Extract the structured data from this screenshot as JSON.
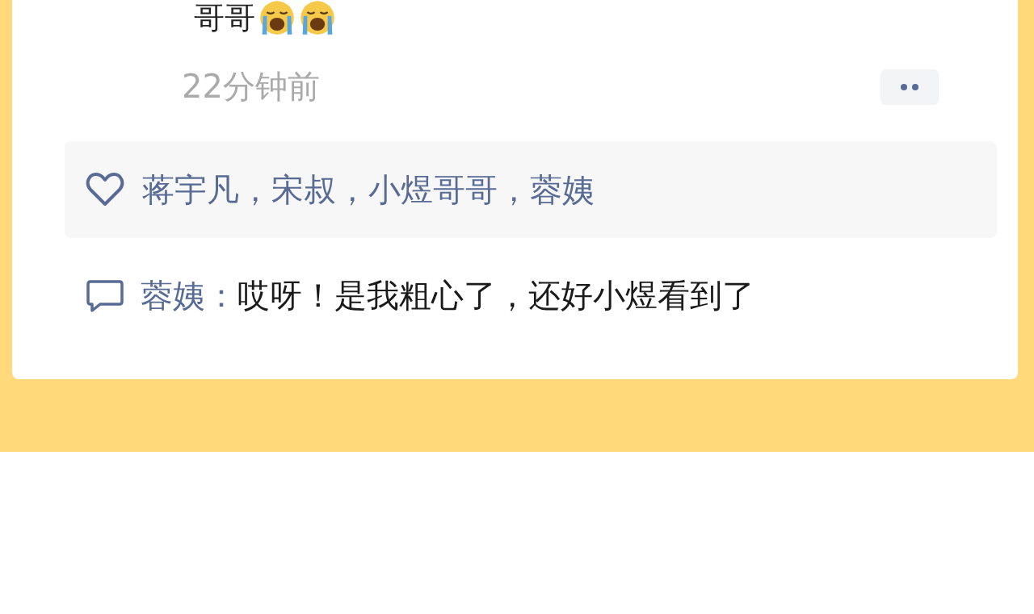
{
  "post": {
    "text": "哥哥",
    "emojis": [
      {
        "kind": "crying"
      },
      {
        "kind": "crying"
      }
    ],
    "time": "22分钟前"
  },
  "likes": {
    "names": "蒋宇凡，宋叔，小煜哥哥，蓉姨"
  },
  "comments": [
    {
      "author": "蓉姨：",
      "text": "哎呀！是我粗心了，还好小煜看到了"
    }
  ]
}
